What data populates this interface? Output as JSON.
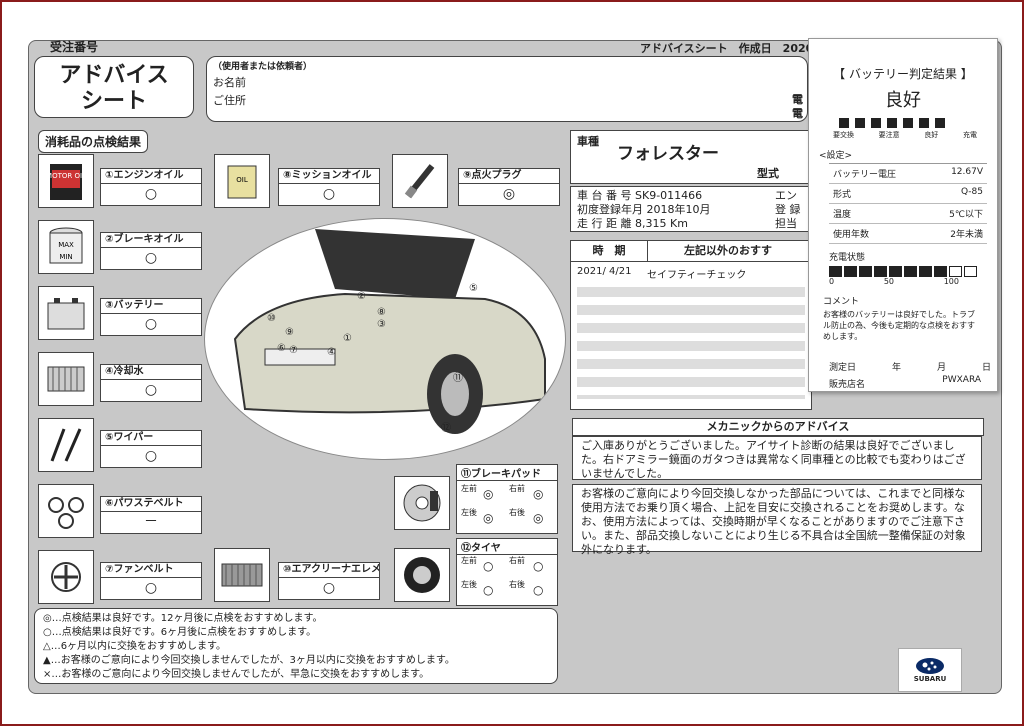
{
  "header": {
    "order_no_label": "受注番号",
    "doc_label": "アドバイスシート　作成日　2020"
  },
  "title": {
    "line1": "アドバイス",
    "line2": "シート"
  },
  "customer": {
    "heading": "（使用者または依頼者）",
    "name_label": "お名前",
    "address_label": "ご住所",
    "partial1": "電",
    "partial2": "電"
  },
  "consumables_label": "消耗品の点検結果",
  "items": [
    {
      "label": "①エンジンオイル",
      "mark": "○"
    },
    {
      "label": "②ブレーキオイル",
      "mark": "○"
    },
    {
      "label": "③バッテリー",
      "mark": "○"
    },
    {
      "label": "④冷却水",
      "mark": "○"
    },
    {
      "label": "⑤ワイパー",
      "mark": "○"
    },
    {
      "label": "⑥パワステベルト",
      "mark": "－"
    },
    {
      "label": "⑦ファンベルト",
      "mark": "○"
    },
    {
      "label": "⑧ミッションオイル",
      "mark": "○"
    },
    {
      "label": "⑨点火プラグ",
      "mark": "◎"
    },
    {
      "label": "⑩エアクリーナエレメント",
      "mark": "○"
    }
  ],
  "icons": {
    "motor_oil": "MOTOR OIL",
    "max": "MAX",
    "min": "MIN",
    "oil": "OIL"
  },
  "brake_pad": {
    "title": "⑪ブレーキパッド",
    "fl": "左前",
    "fr": "右前",
    "rl": "左後",
    "rr": "右後"
  },
  "tire": {
    "title": "⑫タイヤ",
    "fl": "左前",
    "fr": "右前",
    "rl": "左後",
    "rr": "右後"
  },
  "car_numbers": [
    "①",
    "②",
    "③",
    "④",
    "⑤",
    "⑥",
    "⑦",
    "⑧",
    "⑨",
    "⑩",
    "⑪",
    "⑫"
  ],
  "vehicle": {
    "model_label": "車種",
    "model": "フォレスター",
    "type_label": "型式",
    "reg_label": "車 台 番 号",
    "reg": "SK9-011466",
    "engine_label": "エン",
    "first_reg_label": "初度登録年月",
    "first_reg": "2018年10月",
    "reg2_label": "登 録",
    "mileage_label": "走 行 距 離",
    "mileage": "8,315 Km",
    "staff_label": "担当"
  },
  "history": {
    "col_time": "時　期",
    "col_other": "左記以外のおすす",
    "date": "2021/ 4/21",
    "entry": "セイフティーチェック"
  },
  "advice": {
    "title": "メカニックからのアドバイス",
    "p1": "ご入庫ありがとうございました。アイサイト診断の結果は良好でございました。右ドアミラー鏡面のガタつきは異常なく同車種との比較でも変わりはございませんでした。",
    "p2": "お客様のご意向により今回交換しなかった部品については、これまでと同様な使用方法でお乗り頂く場合、上記を目安に交換されることをお奨めします。なお、使用方法によっては、交換時期が早くなることがありますのでご注意下さい。また、部品交換しないことにより生じる不具合は全国統一整備保証の対象外になります。"
  },
  "legend": [
    "◎…点検結果は良好です。12ヶ月後に点検をおすすめします。",
    "○…点検結果は良好です。6ヶ月後に点検をおすすめします。",
    "△…6ヶ月以内に交換をおすすめします。",
    "▲…お客様のご意向により今回交換しませんでしたが、3ヶ月以内に交換をおすすめします。",
    "×…お客様のご意向により今回交換しませんでしたが、早急に交換をおすすめします。"
  ],
  "receipt": {
    "title": "【 バッテリー判定結果 】",
    "result": "良好",
    "scale": [
      "要交換",
      "要注意",
      "良好",
      "充電"
    ],
    "settings": "<設定>",
    "rows": [
      {
        "k": "バッテリー電圧",
        "v": "12.67V"
      },
      {
        "k": "形式",
        "v": "Q-85"
      },
      {
        "k": "温度",
        "v": "5℃以下"
      },
      {
        "k": "使用年数",
        "v": "2年未満"
      }
    ],
    "charge_label": "充電状態",
    "charge_fill": 0.8,
    "charge_ticks": [
      "0",
      "50",
      "100"
    ],
    "comment_label": "コメント",
    "comment": "お客様のバッテリーは良好でした。トラブル防止の為、今後も定期的な点検をおすすめします。",
    "date_label": "測定日",
    "y": "年",
    "m": "月",
    "d": "日",
    "shop_label": "販売店名",
    "brand": "PWXARA"
  },
  "logo": "SUBARU"
}
